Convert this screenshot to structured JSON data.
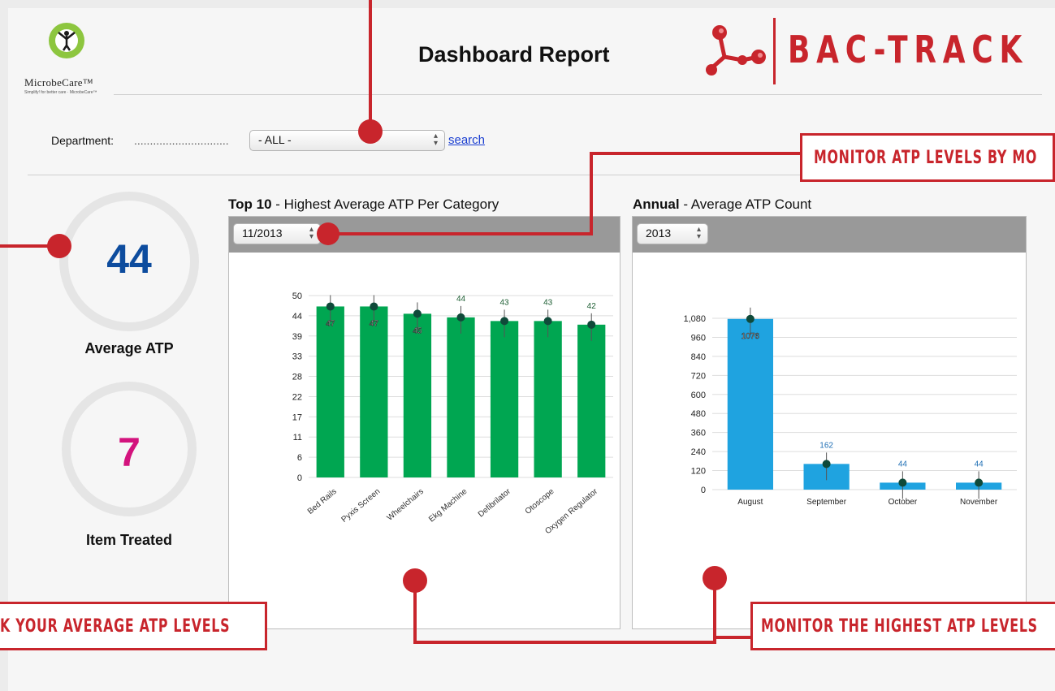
{
  "header": {
    "logo_name": "MicrobeCare™",
    "logo_tagline": "Simplify! for better care · MicrobeCare™",
    "title": "Dashboard Report",
    "brand": "BAC-TRACK"
  },
  "filters": {
    "department_label": "Department:",
    "department_dots": "..............................",
    "department_value": "- ALL -",
    "search_label": "search"
  },
  "stats": {
    "average_atp": {
      "value": "44",
      "label": "Average ATP",
      "color": "#0d4c9e"
    },
    "item_treated": {
      "value": "7",
      "label": "Item Treated",
      "color": "#d3137d"
    }
  },
  "top10": {
    "title_bold": "Top 10",
    "title_rest": " - Highest Average ATP Per Category",
    "period": "11/2013"
  },
  "annual": {
    "title_bold": "Annual",
    "title_rest": " - Average ATP Count",
    "period": "2013"
  },
  "callouts": {
    "months": "MONITOR ATP LEVELS BY MO",
    "average": "K YOUR AVERAGE ATP LEVELS",
    "highest": "MONITOR THE HIGHEST ATP LEVELS"
  },
  "colors": {
    "green_bar": "#00a651",
    "blue_bar": "#1fa3e0",
    "callout_red": "#c8252c",
    "panel_header": "#999999"
  },
  "chart_data": [
    {
      "type": "bar",
      "categories": [
        "Bed Rails",
        "Pyxis Screen",
        "Wheelchairs",
        "Ekg Machine",
        "Defibrilator",
        "Otoscope",
        "Oxygen Regulator"
      ],
      "values": [
        47,
        47,
        45,
        44,
        43,
        43,
        42
      ],
      "labels": [
        "47",
        "47",
        "45",
        "44",
        "43",
        "43",
        "42"
      ],
      "yticks": [
        "0",
        "6",
        "11",
        "17",
        "22",
        "28",
        "33",
        "39",
        "44",
        "50"
      ],
      "ylim": [
        0,
        50
      ],
      "grid": true
    },
    {
      "type": "bar",
      "categories": [
        "August",
        "September",
        "October",
        "November"
      ],
      "values": [
        1076,
        162,
        44,
        44
      ],
      "labels": [
        "1076",
        "162",
        "44",
        "44"
      ],
      "yticks": [
        "0",
        "120",
        "240",
        "360",
        "480",
        "600",
        "720",
        "840",
        "960",
        "1,080"
      ],
      "ylim": [
        0,
        1080
      ],
      "grid": true
    }
  ]
}
